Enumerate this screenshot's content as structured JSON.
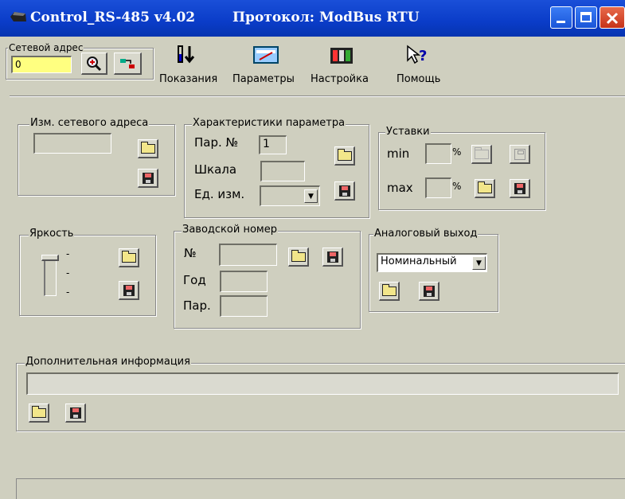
{
  "window": {
    "title": "Control_RS-485 v4.02",
    "protocol": "Протокол: ModBus RTU"
  },
  "toolbar": {
    "network_address_label": "Сетевой адрес",
    "network_address_value": "0",
    "readings": "Показания",
    "parameters": "Параметры",
    "settings": "Настройка",
    "help": "Помощь"
  },
  "change_address": {
    "label": "Изм. сетевого адреса",
    "value": ""
  },
  "param_chars": {
    "label": "Характеристики параметра",
    "param_no_label": "Пар. №",
    "param_no_value": "1",
    "scale_label": "Шкала",
    "scale_value": "",
    "unit_label": "Ед. изм.",
    "unit_value": ""
  },
  "setpoints": {
    "label": "Уставки",
    "min_label": "min",
    "max_label": "max",
    "percent": "%",
    "min_value": "",
    "max_value": ""
  },
  "brightness": {
    "label": "Яркость",
    "level_mark": "-"
  },
  "serial": {
    "label": "Заводской номер",
    "no_label": "№",
    "year_label": "Год",
    "par_label": "Пар.",
    "no_value": "",
    "year_value": "",
    "par_value": ""
  },
  "analog_output": {
    "label": "Аналоговый выход",
    "selected": "Номинальный"
  },
  "extra_info": {
    "label": "Дополнительная информация",
    "value": ""
  }
}
